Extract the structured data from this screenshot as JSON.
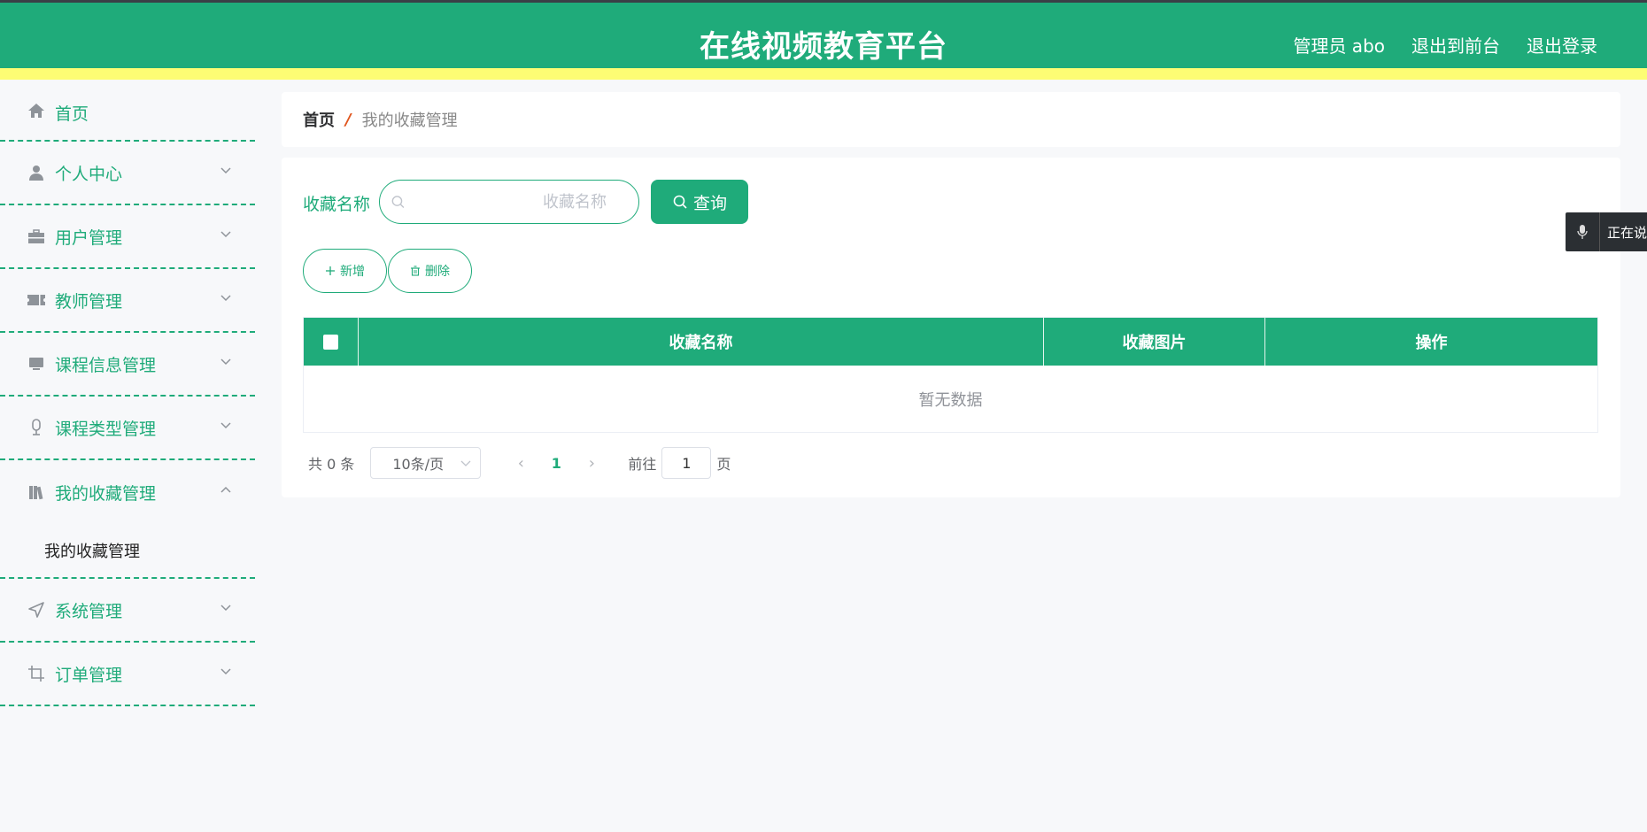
{
  "header": {
    "title": "在线视频教育平台",
    "admin_label": "管理员 abo",
    "exit_front_label": "退出到前台",
    "logout_label": "退出登录"
  },
  "sidebar": {
    "items": [
      {
        "label": "首页",
        "icon": "home-icon"
      },
      {
        "label": "个人中心",
        "icon": "user-icon"
      },
      {
        "label": "用户管理",
        "icon": "briefcase-icon"
      },
      {
        "label": "教师管理",
        "icon": "ticket-icon"
      },
      {
        "label": "课程信息管理",
        "icon": "monitor-icon"
      },
      {
        "label": "课程类型管理",
        "icon": "microphone-icon"
      },
      {
        "label": "我的收藏管理",
        "icon": "books-icon",
        "expanded": true
      },
      {
        "label": "系统管理",
        "icon": "navigation-icon"
      },
      {
        "label": "订单管理",
        "icon": "crop-icon"
      }
    ],
    "submenu": {
      "label": "我的收藏管理"
    }
  },
  "breadcrumb": {
    "home": "首页",
    "separator": "/",
    "current": "我的收藏管理"
  },
  "search": {
    "label": "收藏名称",
    "placeholder": "收藏名称",
    "value": "",
    "query_label": "查询"
  },
  "actions": {
    "add_label": "新增",
    "delete_label": "删除"
  },
  "table": {
    "columns": [
      "收藏名称",
      "收藏图片",
      "操作"
    ],
    "empty_text": "暂无数据"
  },
  "pagination": {
    "total": "共 0 条",
    "page_size": "10条/页",
    "current_page": "1",
    "goto_label": "前往",
    "goto_value": "1",
    "page_suffix": "页"
  },
  "voice_tooltip": {
    "text": "正在说"
  },
  "colors": {
    "primary": "#1fab7a",
    "header_accent": "#fdfd74",
    "breadcrumb_separator": "#e0561f"
  }
}
